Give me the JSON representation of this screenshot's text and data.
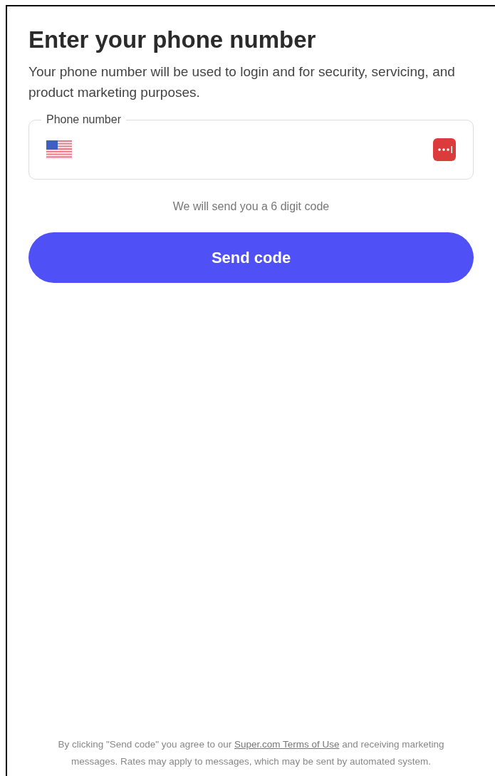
{
  "title": "Enter your phone number",
  "description": "Your phone number will be used to login and for security, servicing, and product marketing purposes.",
  "phone_field": {
    "label": "Phone number"
  },
  "hint": "We will send you a 6 digit code",
  "send_button": "Send code",
  "footer": {
    "before": "By clicking \"Send code\" you agree to our ",
    "link": "Super.com Terms of Use",
    "after": " and receiving marketing messages. Rates may apply to messages, which may be sent by automated system."
  }
}
